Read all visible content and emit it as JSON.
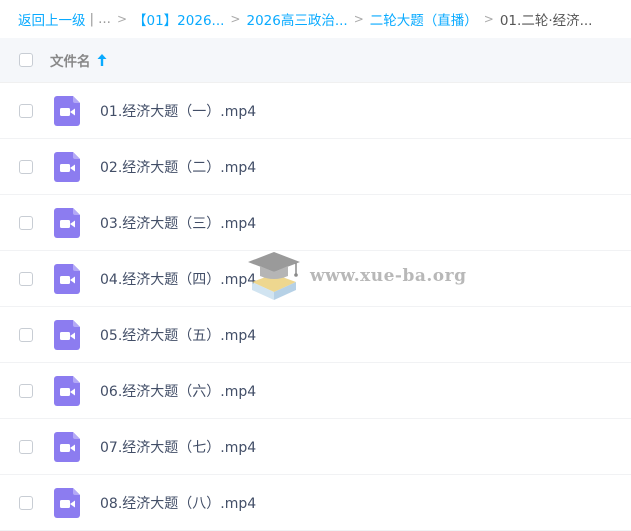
{
  "breadcrumb": {
    "back": "返回上一级",
    "divider": "|",
    "ellipsis": "...",
    "items": [
      "【01】2026...",
      "2026高三政治...",
      "二轮大题（直播）"
    ],
    "current": "01.二轮·经济..."
  },
  "header": {
    "column_name": "文件名",
    "sort_icon": "arrow-up-icon"
  },
  "files": [
    {
      "name": "01.经济大题（一）.mp4"
    },
    {
      "name": "02.经济大题（二）.mp4"
    },
    {
      "name": "03.经济大题（三）.mp4"
    },
    {
      "name": "04.经济大题（四）.mp4"
    },
    {
      "name": "05.经济大题（五）.mp4"
    },
    {
      "name": "06.经济大题（六）.mp4"
    },
    {
      "name": "07.经济大题（七）.mp4"
    },
    {
      "name": "08.经济大题（八）.mp4"
    }
  ],
  "watermark": {
    "text": "www.xue-ba.org"
  },
  "colors": {
    "accent": "#09AAFF",
    "video_icon": "#8C7CF0",
    "header_bg": "#F5F7FA"
  }
}
